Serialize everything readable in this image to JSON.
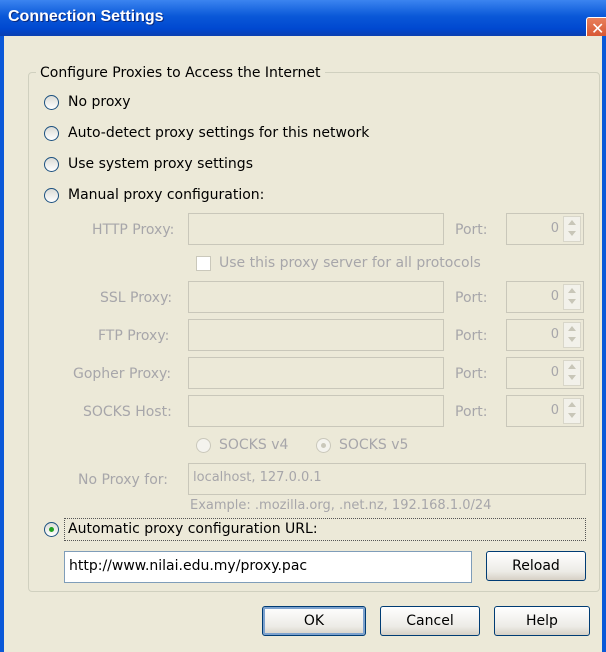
{
  "window": {
    "title": "Connection Settings",
    "close_glyph": "✕"
  },
  "group_label": "Configure Proxies to Access the Internet",
  "radios": {
    "no_proxy": "No proxy",
    "auto_detect": "Auto-detect proxy settings for this network",
    "system": "Use system proxy settings",
    "manual": "Manual proxy configuration:",
    "auto_url": "Automatic proxy configuration URL:"
  },
  "manual": {
    "http_label": "HTTP Proxy:",
    "ssl_label": "SSL Proxy:",
    "ftp_label": "FTP Proxy:",
    "gopher_label": "Gopher Proxy:",
    "socks_label": "SOCKS Host:",
    "port_label": "Port:",
    "port_value": "0",
    "use_all_label": "Use this proxy server for all protocols",
    "socks_v4": "SOCKS v4",
    "socks_v5": "SOCKS v5",
    "no_proxy_label": "No Proxy for:",
    "no_proxy_value": "localhost, 127.0.0.1",
    "example": "Example: .mozilla.org, .net.nz, 192.168.1.0/24"
  },
  "auto": {
    "url_value": "http://www.nilai.edu.my/proxy.pac",
    "reload_label": "Reload"
  },
  "buttons": {
    "ok": "OK",
    "cancel": "Cancel",
    "help": "Help"
  },
  "selected_option": "auto_url",
  "socks_selected": "v5",
  "colors": {
    "title_blue": "#0a58d8",
    "radio_dot": "#21a121",
    "disabled_text": "#a7a6aa",
    "dialog_bg": "#ece9d8"
  }
}
